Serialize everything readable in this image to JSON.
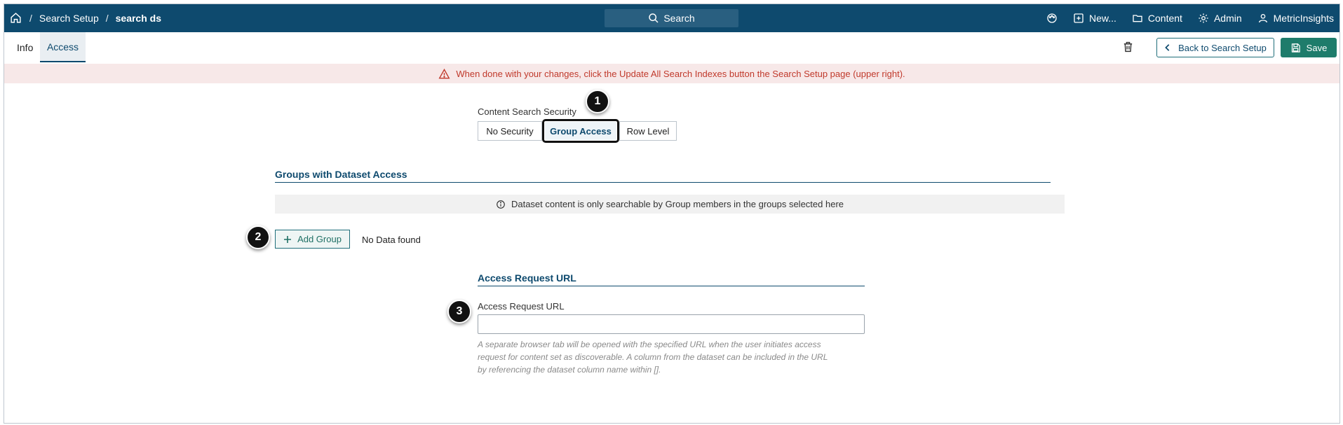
{
  "breadcrumb": {
    "sep": "/",
    "items": [
      "Search Setup",
      "search ds"
    ]
  },
  "search": {
    "label": "Search"
  },
  "topnav": {
    "new": "New...",
    "content": "Content",
    "admin": "Admin",
    "user": "MetricInsights"
  },
  "tabs": {
    "info": "Info",
    "access": "Access"
  },
  "actions": {
    "back": "Back to Search Setup",
    "save": "Save"
  },
  "warning": {
    "text": "When done with your changes, click the Update All Search Indexes button the Search Setup page (upper right)."
  },
  "content_security": {
    "label": "Content Search Security",
    "options": [
      "No Security",
      "Group Access",
      "Row Level"
    ],
    "selected": "Group Access"
  },
  "groups": {
    "title": "Groups with Dataset Access",
    "info": "Dataset content is only searchable by Group members in the groups selected here",
    "add_label": "Add Group",
    "empty": "No Data found"
  },
  "access_request": {
    "title": "Access Request URL",
    "field_label": "Access Request URL",
    "value": "",
    "help_lines": [
      "A separate browser tab will be opened with the specified URL when the user initiates access",
      "request for content set as discoverable. A column from the dataset can be included in the URL",
      "by referencing the dataset column name within []."
    ]
  },
  "markers": [
    "1",
    "2",
    "3"
  ],
  "colors": {
    "topbar": "#0e4a6e",
    "save": "#1e7c6b",
    "warning_text": "#c0392b",
    "warning_bg": "#f7e8e8"
  },
  "icons": [
    "home-icon",
    "search-icon",
    "palette-icon",
    "plus-square-icon",
    "folder-icon",
    "gear-icon",
    "user-icon",
    "trash-icon",
    "chevron-left-icon",
    "save-disk-icon",
    "warning-triangle-icon",
    "info-circle-icon",
    "plus-icon"
  ]
}
